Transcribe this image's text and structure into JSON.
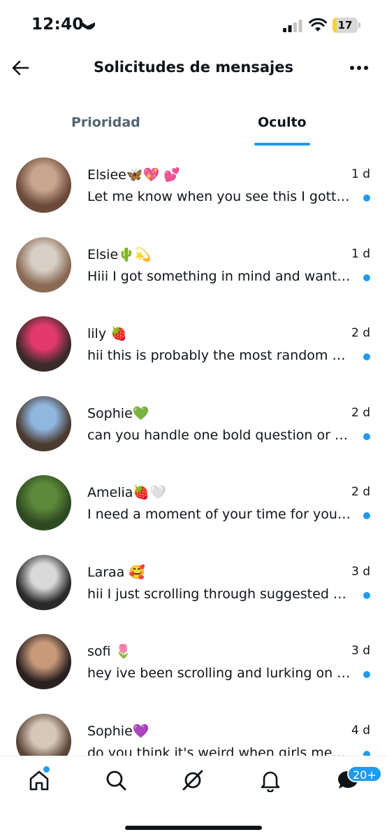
{
  "status_bar": {
    "time": "12:40",
    "battery_level": "17",
    "battery_fraction": 0.17,
    "focus_icon": "bed-icon",
    "signal_icon": "cellular-signal-icon",
    "wifi_icon": "wifi-icon"
  },
  "header": {
    "title": "Solicitudes de mensajes",
    "back_icon": "arrow-left-icon",
    "more_icon": "more-horizontal-icon"
  },
  "tabs": [
    {
      "label": "Prioridad",
      "active": false
    },
    {
      "label": "Oculto",
      "active": true
    }
  ],
  "conversations": [
    {
      "name": "Elsiee🦋💖 💕",
      "time": "1 d",
      "preview": "Let me know when you see this I gotta...",
      "unread": true,
      "avatar_colors": [
        "#c9a48e",
        "#6b4a3a"
      ]
    },
    {
      "name": "Elsie🌵💫",
      "time": "1 d",
      "preview": "Hiii I got something in mind and want y...",
      "unread": true,
      "avatar_colors": [
        "#d8cfc6",
        "#8a6a55"
      ]
    },
    {
      "name": "lily 🍓",
      "time": "2 d",
      "preview": "hii this is probably the most random hi...",
      "unread": true,
      "avatar_colors": [
        "#e23a6a",
        "#3a2a2a"
      ]
    },
    {
      "name": "Sophie💚",
      "time": "2 d",
      "preview": "can you handle one bold question or s...",
      "unread": true,
      "avatar_colors": [
        "#8fb7e0",
        "#4a3a30"
      ]
    },
    {
      "name": "Amelia🍓🤍",
      "time": "2 d",
      "preview": "I need a moment of your time for your...",
      "unread": true,
      "avatar_colors": [
        "#5d8a3a",
        "#2f4a22"
      ]
    },
    {
      "name": "Laraa 🥰",
      "time": "3 d",
      "preview": "hii I just scrolling through suggested an...",
      "unread": true,
      "avatar_colors": [
        "#d9d9d9",
        "#2a2a2a"
      ]
    },
    {
      "name": "sofi 🌷",
      "time": "3 d",
      "preview": "hey ive been scrolling and lurking on pe...",
      "unread": true,
      "avatar_colors": [
        "#c99a7a",
        "#2a2020"
      ]
    },
    {
      "name": "Sophie💜",
      "time": "4 d",
      "preview": "do you think it's weird when girls mess...",
      "unread": true,
      "avatar_colors": [
        "#d6c7b8",
        "#5a4438"
      ]
    }
  ],
  "bottom_nav": {
    "items": [
      "home-icon",
      "search-icon",
      "grok-icon",
      "notifications-bell-icon",
      "messages-icon"
    ],
    "messages_badge": "20+"
  },
  "colors": {
    "accent": "#1d9bf0",
    "text": "#0f1419",
    "secondary_text": "#536471"
  }
}
